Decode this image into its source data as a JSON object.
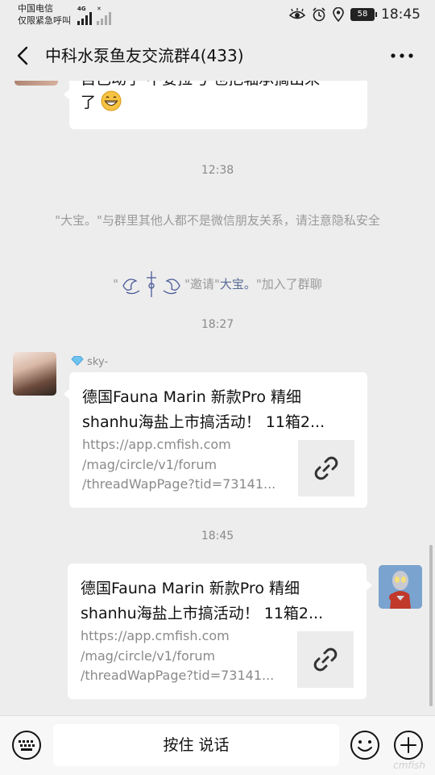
{
  "status_bar": {
    "carrier_line1": "中国电信",
    "carrier_line2": "仅限紧急呼叫",
    "network_tag": "4G",
    "battery": "58",
    "time": "18:45"
  },
  "header": {
    "title": "中科水泵鱼友交流群4(433)"
  },
  "messages": {
    "partial": {
      "line1": "自己动手 不要拉弓 也把轴承搞出来",
      "line2": "了"
    },
    "time1": "12:38",
    "system1": "\"大宝。\"与群里其他人都不是微信朋友关系，请注意隐私安全",
    "system2": {
      "quote_open": "\"",
      "inviter_suffix": "\"邀请\"",
      "invitee": "大宝。",
      "join_text": "\"加入了群聊"
    },
    "time2": "18:27",
    "msg1": {
      "sender": "sky-",
      "title_line1": "德国Fauna Marin 新款Pro 精细",
      "title_line2": "shanhu海盐上市搞活动！ 11箱2...",
      "url_line1": "https://app.cmfish.com",
      "url_line2": "/mag/circle/v1/forum",
      "url_line3": "/threadWapPage?tid=73141..."
    },
    "time3": "18:45",
    "msg2": {
      "title_line1": "德国Fauna Marin 新款Pro 精细",
      "title_line2": "shanhu海盐上市搞活动！ 11箱2...",
      "url_line1": "https://app.cmfish.com",
      "url_line2": "/mag/circle/v1/forum",
      "url_line3": "/threadWapPage?tid=73141..."
    }
  },
  "input_bar": {
    "hold_to_talk": "按住 说话"
  },
  "watermark": "cmfish",
  "colors": {
    "background": "#ededed",
    "bubble": "#ffffff",
    "link_blue": "#576b95",
    "muted_text": "#8a8a8a"
  },
  "icons": {
    "back": "chevron-left-icon",
    "more": "more-dots-icon",
    "link": "link-chain-icon",
    "keyboard": "keyboard-icon",
    "emoji": "smiley-icon",
    "plus": "plus-circle-icon"
  }
}
